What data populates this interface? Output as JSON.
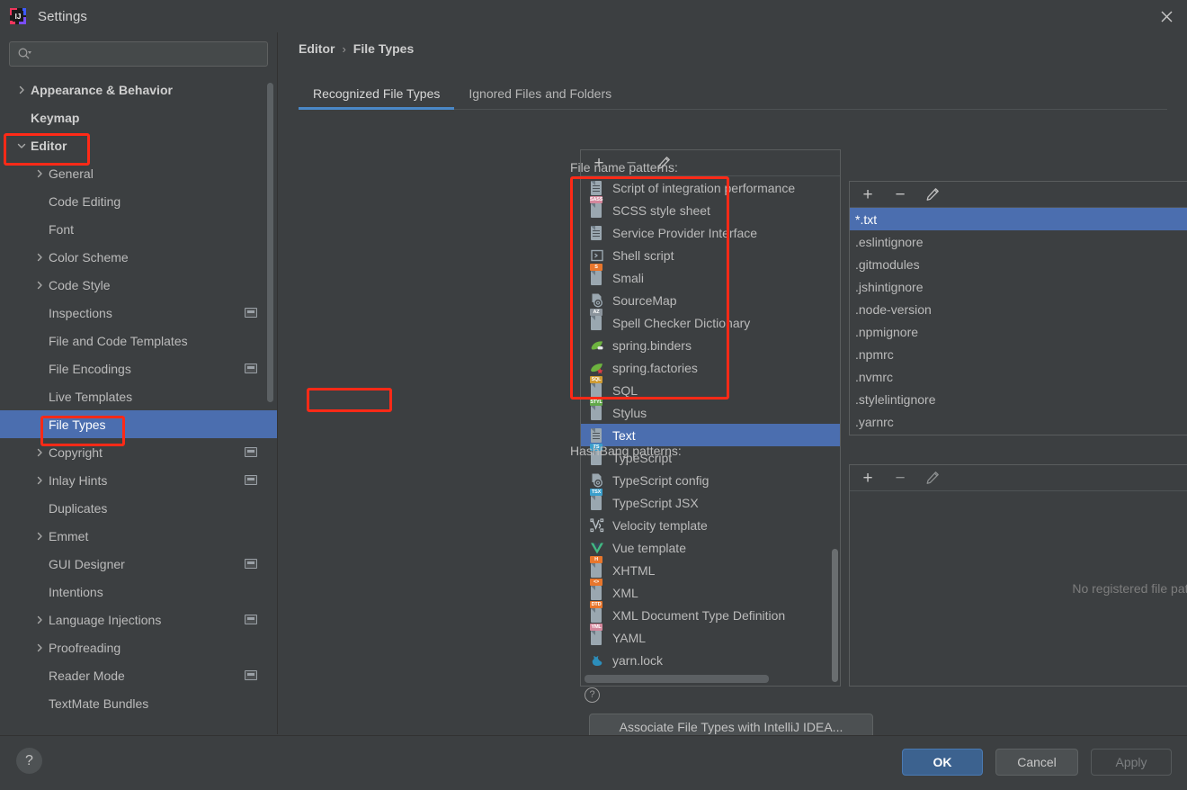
{
  "window": {
    "title": "Settings",
    "logo_icon": "intellij-idea-logo",
    "close_icon": "close-icon"
  },
  "sidebar": {
    "search": {
      "placeholder": "",
      "value": "",
      "icon": "search-icon",
      "dropdown_icon": "chevron-down-icon"
    },
    "items": [
      {
        "label": "Appearance & Behavior",
        "indent": 0,
        "arrow": "collapsed",
        "bold": true,
        "selected": false,
        "badge": false
      },
      {
        "label": "Keymap",
        "indent": 0,
        "arrow": "none",
        "bold": true,
        "selected": false,
        "badge": false
      },
      {
        "label": "Editor",
        "indent": 0,
        "arrow": "expanded",
        "bold": true,
        "selected": false,
        "badge": false
      },
      {
        "label": "General",
        "indent": 1,
        "arrow": "collapsed",
        "bold": false,
        "selected": false,
        "badge": false
      },
      {
        "label": "Code Editing",
        "indent": 1,
        "arrow": "none",
        "bold": false,
        "selected": false,
        "badge": false
      },
      {
        "label": "Font",
        "indent": 1,
        "arrow": "none",
        "bold": false,
        "selected": false,
        "badge": false
      },
      {
        "label": "Color Scheme",
        "indent": 1,
        "arrow": "collapsed",
        "bold": false,
        "selected": false,
        "badge": false
      },
      {
        "label": "Code Style",
        "indent": 1,
        "arrow": "collapsed",
        "bold": false,
        "selected": false,
        "badge": false
      },
      {
        "label": "Inspections",
        "indent": 1,
        "arrow": "none",
        "bold": false,
        "selected": false,
        "badge": true
      },
      {
        "label": "File and Code Templates",
        "indent": 1,
        "arrow": "none",
        "bold": false,
        "selected": false,
        "badge": false
      },
      {
        "label": "File Encodings",
        "indent": 1,
        "arrow": "none",
        "bold": false,
        "selected": false,
        "badge": true
      },
      {
        "label": "Live Templates",
        "indent": 1,
        "arrow": "none",
        "bold": false,
        "selected": false,
        "badge": false
      },
      {
        "label": "File Types",
        "indent": 1,
        "arrow": "none",
        "bold": false,
        "selected": true,
        "badge": false
      },
      {
        "label": "Copyright",
        "indent": 1,
        "arrow": "collapsed",
        "bold": false,
        "selected": false,
        "badge": true
      },
      {
        "label": "Inlay Hints",
        "indent": 1,
        "arrow": "collapsed",
        "bold": false,
        "selected": false,
        "badge": true
      },
      {
        "label": "Duplicates",
        "indent": 1,
        "arrow": "none",
        "bold": false,
        "selected": false,
        "badge": false
      },
      {
        "label": "Emmet",
        "indent": 1,
        "arrow": "collapsed",
        "bold": false,
        "selected": false,
        "badge": false
      },
      {
        "label": "GUI Designer",
        "indent": 1,
        "arrow": "none",
        "bold": false,
        "selected": false,
        "badge": true
      },
      {
        "label": "Intentions",
        "indent": 1,
        "arrow": "none",
        "bold": false,
        "selected": false,
        "badge": false
      },
      {
        "label": "Language Injections",
        "indent": 1,
        "arrow": "collapsed",
        "bold": false,
        "selected": false,
        "badge": true
      },
      {
        "label": "Proofreading",
        "indent": 1,
        "arrow": "collapsed",
        "bold": false,
        "selected": false,
        "badge": false
      },
      {
        "label": "Reader Mode",
        "indent": 1,
        "arrow": "none",
        "bold": false,
        "selected": false,
        "badge": true
      },
      {
        "label": "TextMate Bundles",
        "indent": 1,
        "arrow": "none",
        "bold": false,
        "selected": false,
        "badge": false
      }
    ]
  },
  "breadcrumb": {
    "parent": "Editor",
    "separator": "›",
    "current": "File Types"
  },
  "tabs": [
    {
      "label": "Recognized File Types",
      "active": true
    },
    {
      "label": "Ignored Files and Folders",
      "active": false
    }
  ],
  "file_types_panel": {
    "toolbar": {
      "add_label": "+",
      "remove_label": "−",
      "edit_icon": "pencil-icon",
      "remove_enabled": false
    },
    "items": [
      {
        "label": "Script of integration performance",
        "icon": "text-file-icon",
        "tag": "",
        "tag_color": "",
        "selected": false
      },
      {
        "label": "SCSS style sheet",
        "icon": "file-tag-icon",
        "tag": "SASS",
        "tag_color": "#d4879c",
        "selected": false
      },
      {
        "label": "Service Provider Interface",
        "icon": "text-file-icon",
        "tag": "",
        "tag_color": "",
        "selected": false
      },
      {
        "label": "Shell script",
        "icon": "shell-script-icon",
        "tag": "",
        "tag_color": "",
        "selected": false
      },
      {
        "label": "Smali",
        "icon": "file-tag-icon",
        "tag": "S",
        "tag_color": "#e8762c",
        "selected": false
      },
      {
        "label": "SourceMap",
        "icon": "config-gear-file-icon",
        "tag": "",
        "tag_color": "",
        "selected": false
      },
      {
        "label": "Spell Checker Dictionary",
        "icon": "file-tag-icon",
        "tag": "AZ",
        "tag_color": "#8b949c",
        "selected": false
      },
      {
        "label": "spring.binders",
        "icon": "spring-leaf-icon",
        "tag": "",
        "tag_color": "",
        "selected": false
      },
      {
        "label": "spring.factories",
        "icon": "spring-leaf-star-icon",
        "tag": "",
        "tag_color": "",
        "selected": false
      },
      {
        "label": "SQL",
        "icon": "file-tag-icon",
        "tag": "SQL",
        "tag_color": "#cf9b33",
        "selected": false
      },
      {
        "label": "Stylus",
        "icon": "file-tag-icon",
        "tag": "STYL",
        "tag_color": "#62a84a",
        "selected": false
      },
      {
        "label": "Text",
        "icon": "text-file-icon",
        "tag": "",
        "tag_color": "",
        "selected": true
      },
      {
        "label": "TypeScript",
        "icon": "file-tag-icon",
        "tag": "TS",
        "tag_color": "#3a9ecb",
        "selected": false
      },
      {
        "label": "TypeScript config",
        "icon": "config-gear-file-icon",
        "tag": "",
        "tag_color": "",
        "selected": false
      },
      {
        "label": "TypeScript JSX",
        "icon": "file-tag-icon",
        "tag": "TSX",
        "tag_color": "#3a9ecb",
        "selected": false
      },
      {
        "label": "Velocity template",
        "icon": "velocity-template-icon",
        "tag": "",
        "tag_color": "",
        "selected": false
      },
      {
        "label": "Vue template",
        "icon": "vue-icon",
        "tag": "",
        "tag_color": "",
        "selected": false
      },
      {
        "label": "XHTML",
        "icon": "file-tag-icon",
        "tag": "H",
        "tag_color": "#e8762c",
        "selected": false
      },
      {
        "label": "XML",
        "icon": "file-tag-icon",
        "tag": "<>",
        "tag_color": "#e8762c",
        "selected": false
      },
      {
        "label": "XML Document Type Definition",
        "icon": "file-tag-icon",
        "tag": "DTD",
        "tag_color": "#e8762c",
        "selected": false
      },
      {
        "label": "YAML",
        "icon": "file-tag-icon",
        "tag": "YML",
        "tag_color": "#d4879c",
        "selected": false
      },
      {
        "label": "yarn.lock",
        "icon": "yarn-cat-icon",
        "tag": "",
        "tag_color": "",
        "selected": false
      }
    ]
  },
  "file_name_patterns": {
    "label": "File name patterns:",
    "toolbar": {
      "add_label": "+",
      "remove_label": "−",
      "edit_icon": "pencil-icon",
      "remove_enabled": true
    },
    "items": [
      {
        "label": "*.txt",
        "selected": true
      },
      {
        "label": ".eslintignore",
        "selected": false
      },
      {
        "label": ".gitmodules",
        "selected": false
      },
      {
        "label": ".jshintignore",
        "selected": false
      },
      {
        "label": ".node-version",
        "selected": false
      },
      {
        "label": ".npmignore",
        "selected": false
      },
      {
        "label": ".npmrc",
        "selected": false
      },
      {
        "label": ".nvmrc",
        "selected": false
      },
      {
        "label": ".stylelintignore",
        "selected": false
      },
      {
        "label": ".yarnrc",
        "selected": false
      }
    ]
  },
  "hashbang_patterns": {
    "label": "HashBang patterns:",
    "toolbar": {
      "add_label": "+",
      "remove_label": "−",
      "edit_icon": "pencil-icon",
      "remove_enabled": false
    },
    "empty_message": "No registered file patterns",
    "items": []
  },
  "associate_button": {
    "label": "Associate File Types with IntelliJ IDEA...",
    "help_icon": "help-circle-icon"
  },
  "footer": {
    "help_label": "?",
    "ok_label": "OK",
    "cancel_label": "Cancel",
    "apply_label": "Apply",
    "apply_enabled": false
  },
  "colors": {
    "background": "#3c3f41",
    "selection_blue": "#4b6eaf",
    "tab_underline": "#4a88c7",
    "annotation_red": "#ff2a17",
    "ok_button": "#3c628f"
  },
  "annotations": [
    {
      "name": "editor-tree-item-highlight"
    },
    {
      "name": "file-types-tree-item-highlight"
    },
    {
      "name": "text-file-type-highlight"
    },
    {
      "name": "file-name-patterns-highlight"
    }
  ]
}
